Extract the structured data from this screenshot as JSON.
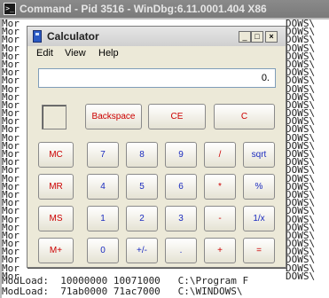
{
  "background_window": {
    "title": "Command - Pid 3516 - WinDbg:6.11.0001.404 X86",
    "left_lines": [
      "Mor",
      "Mor",
      "Mor",
      "Mor",
      "Mor",
      "Mor",
      "Mor",
      "Mor",
      "Mor",
      "Mor",
      "Mor",
      "Mor",
      "Mor",
      "Mor",
      "Mor",
      "Mor",
      "Mor",
      "Mor",
      "Mor",
      "Mor",
      "Mor",
      "Mor",
      "Mor",
      "Mor",
      "Mor",
      "Mor",
      "Mor",
      "Mor",
      "Mor",
      "Mor",
      "Mor",
      "Mor"
    ],
    "right_lines": [
      "DOWS\\",
      "DOWS\\",
      "DOWS\\",
      "DOWS\\",
      "DOWS\\",
      "DOWS\\",
      "DOWS\\",
      "DOWS\\",
      "DOWS\\",
      "DOWS\\",
      "DOWS\\",
      "DOWS\\",
      "DOWS\\",
      "DOWS\\",
      "DOWS\\",
      "DOWS\\",
      "DOWS\\",
      "DOWS\\",
      "DOWS\\",
      "DOWS\\",
      "DOWS\\",
      "DOWS\\",
      "DOWS\\",
      "DOWS\\",
      "DOWS\\",
      "DOWS\\",
      "DOWS\\",
      "DOWS\\",
      "DOWS\\",
      "DOWS\\",
      "DOWS\\",
      "DOWS\\"
    ],
    "bottom_lines": [
      "ModLoad:  10000000 10071000   C:\\Program F",
      "ModLoad:  71ab0000 71ac7000   C:\\WINDOWS\\"
    ]
  },
  "calculator": {
    "title": "Calculator",
    "window_buttons": {
      "minimize": "_",
      "maximize": "□",
      "close": "×"
    },
    "menu": [
      "Edit",
      "View",
      "Help"
    ],
    "display_value": "0.",
    "top_buttons": [
      "Backspace",
      "CE",
      "C"
    ],
    "memory_buttons": [
      "MC",
      "MR",
      "MS",
      "M+"
    ],
    "rows": [
      [
        "7",
        "8",
        "9",
        "/",
        "sqrt"
      ],
      [
        "4",
        "5",
        "6",
        "*",
        "%"
      ],
      [
        "1",
        "2",
        "3",
        "-",
        "1/x"
      ],
      [
        "0",
        "+/-",
        ".",
        "+",
        "="
      ]
    ]
  },
  "colors": {
    "red_label": "#cc0000",
    "blue_label": "#1a2bbf",
    "window_bg": "#ece9d8"
  }
}
